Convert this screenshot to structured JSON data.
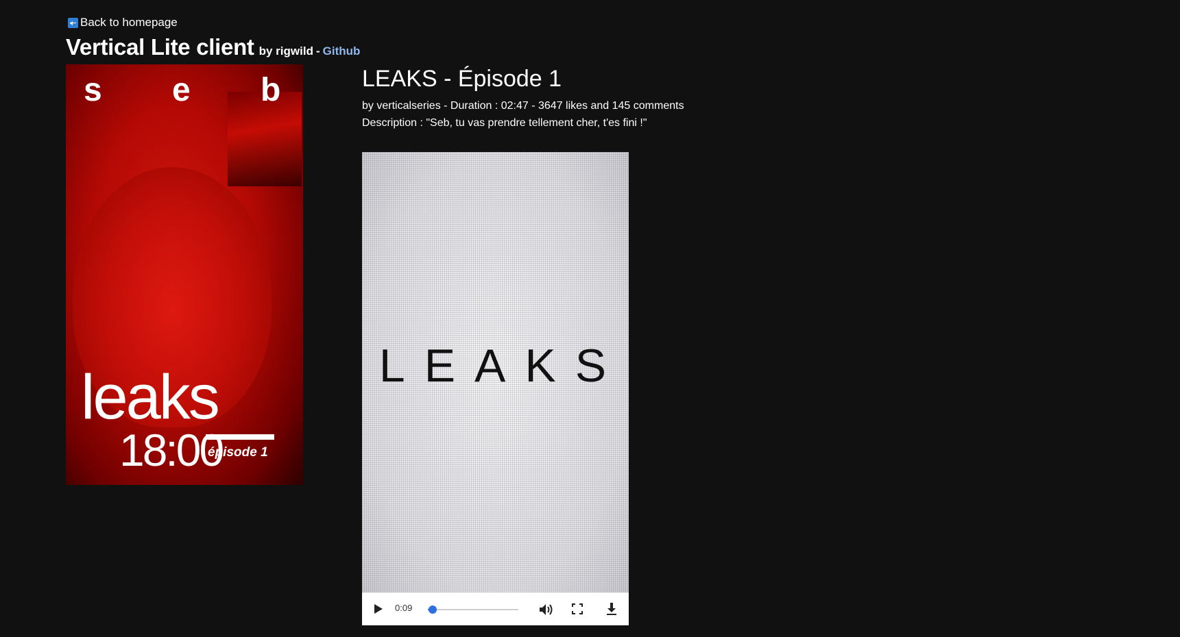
{
  "nav": {
    "back_label": "Back to homepage"
  },
  "header": {
    "title": "Vertical Lite client",
    "by_label": "by rigwild",
    "separator": "-",
    "github_label": "Github"
  },
  "poster": {
    "letters": [
      "s",
      "e",
      "b"
    ],
    "title": "leaks",
    "time": "18:00",
    "episode": "épisode 1"
  },
  "episode": {
    "title": "LEAKS - Épisode 1",
    "meta": "by verticalseries - Duration : 02:47 - 3647 likes and 145 comments",
    "description": "Description : \"Seb, tu vas prendre tellement cher, t'es fini !\""
  },
  "video": {
    "frame_text": "LEAKS",
    "current_time": "0:09",
    "progress_fraction": 0.054
  },
  "icons": {
    "back": "left-arrow-icon",
    "play": "play-icon",
    "volume": "volume-icon",
    "fullscreen": "fullscreen-icon",
    "download": "download-icon"
  },
  "colors": {
    "background": "#111111",
    "link": "#8fb8ec",
    "accent": "#2f6fe0",
    "back_icon": "#2f7fd7"
  }
}
